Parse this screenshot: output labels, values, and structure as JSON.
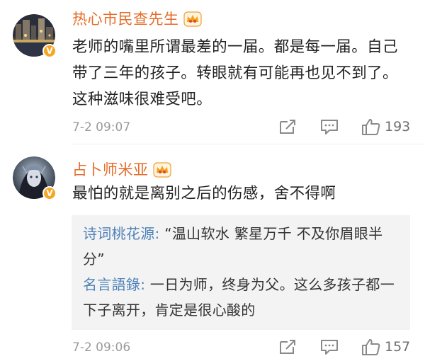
{
  "comments": [
    {
      "username": "热心市民查先生",
      "avatar_icon": "avatar-night-city",
      "badge_icon": "verified-v-badge",
      "vip_icon": "vip-crown-icon",
      "text": "老师的嘴里所谓最差的一届。都是每一届。自己带了三年的孩子。转眼就有可能再也见不到了。这种滋味很难受吧。",
      "timestamp": "7-2 09:07",
      "likes": "193"
    },
    {
      "username": "占卜师米亚",
      "avatar_icon": "avatar-dark-character",
      "badge_icon": "verified-v-badge",
      "vip_icon": "vip-crown-icon",
      "text": "最怕的就是离别之后的伤感，舍不得啊",
      "replies": [
        {
          "user": "诗词桃花源:",
          "text": " “温山软水 繁星万千 不及你眉眼半分”"
        },
        {
          "user": "名言語錄:",
          "text": " 一日为师，终身为父。这么多孩子都一下子离开，肯定是很心酸的"
        }
      ],
      "timestamp": "7-2 09:06",
      "likes": "157"
    }
  ],
  "colors": {
    "username": "#e56d2a",
    "reply_user": "#4d82b9",
    "badge": "#f6a623",
    "reply_background": "#f3f3f3"
  },
  "icons": {
    "share": "share-icon",
    "reply": "comment-icon",
    "like": "thumbs-up-icon"
  }
}
